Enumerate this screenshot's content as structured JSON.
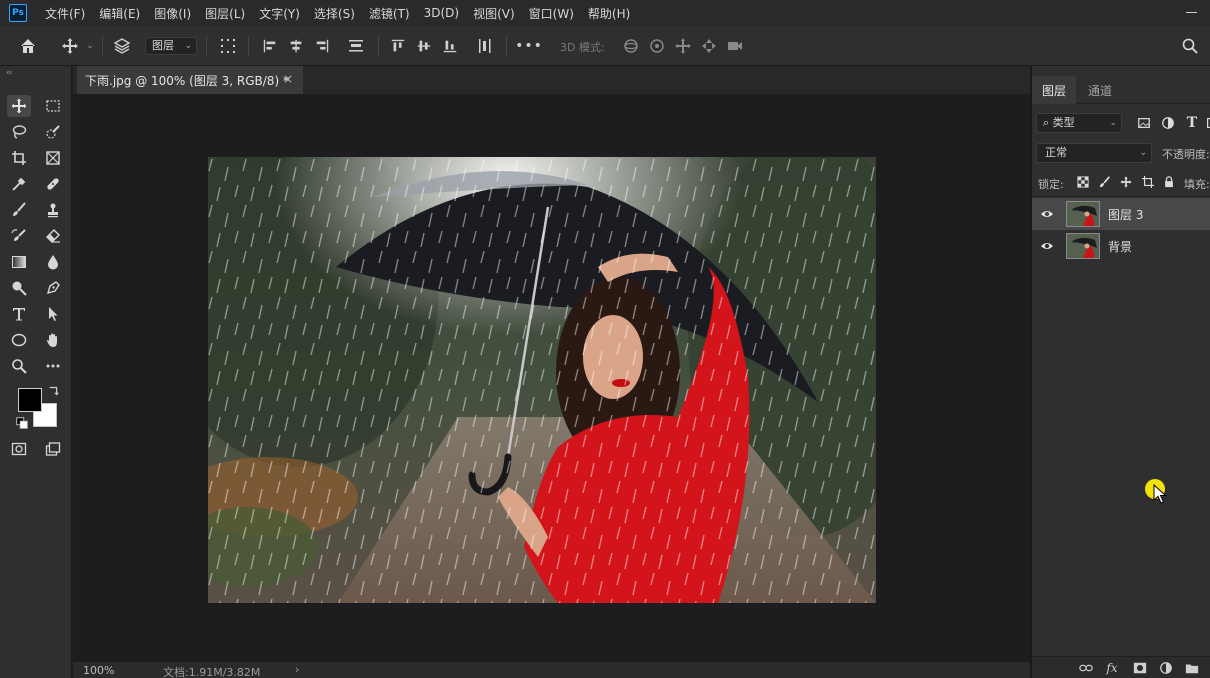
{
  "app": {
    "logo": "Ps"
  },
  "menu": [
    "文件(F)",
    "编辑(E)",
    "图像(I)",
    "图层(L)",
    "文字(Y)",
    "选择(S)",
    "滤镜(T)",
    "3D(D)",
    "视图(V)",
    "窗口(W)",
    "帮助(H)"
  ],
  "options_bar": {
    "layer_select": "图层",
    "mode_3d_label": "3D 模式:",
    "more": "•••"
  },
  "document": {
    "tab_title": "下雨.jpg @ 100% (图层 3, RGB/8) *",
    "close": "×"
  },
  "status": {
    "zoom": "100%",
    "doc_info": "文档:1.91M/3.82M",
    "arrow": "›"
  },
  "layers_panel": {
    "tabs": [
      "图层",
      "通道"
    ],
    "kind_filter": "类型",
    "blend_mode": "正常",
    "opacity_label": "不透明度:",
    "lock_label": "锁定:",
    "fill_label": "填充:",
    "layers": [
      {
        "name": "图层 3",
        "visible": true,
        "selected": true
      },
      {
        "name": "背景",
        "visible": true,
        "selected": false
      }
    ],
    "fx_label": "fx"
  },
  "colors": {
    "foreground": "#000000",
    "background": "#ffffff",
    "accent": "#31a8ff",
    "cursor_highlight": "#f2e20a"
  }
}
